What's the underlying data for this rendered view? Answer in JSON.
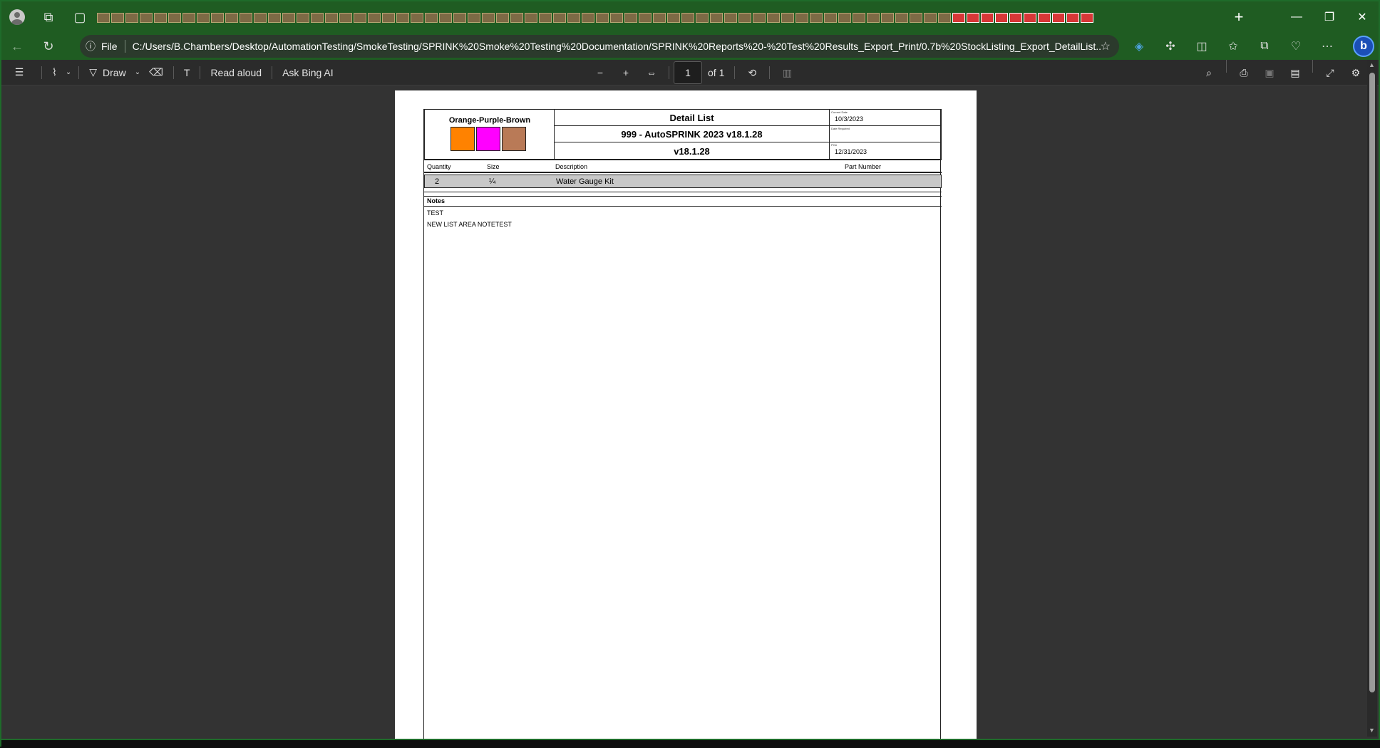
{
  "browser": {
    "url": "C:/Users/B.Chambers/Desktop/AutomationTesting/SmokeTesting/SPRINK%20Smoke%20Testing%20Documentation/SPRINK%20Reports%20-%20Test%20Results_Export_Print/0.7b%20StockListing_Export_DetailList....",
    "file_label": "File",
    "tab_count_generic": 60,
    "tab_count_pdf": 10
  },
  "pdf_toolbar": {
    "draw_label": "Draw",
    "read_aloud_label": "Read aloud",
    "ask_bing_label": "Ask Bing AI",
    "page_number": "1",
    "page_of": "of 1"
  },
  "document": {
    "color_title": "Orange-Purple-Brown",
    "colors": [
      "#ff8200",
      "#ff00ff",
      "#b97a57"
    ],
    "title": "Detail List",
    "project": "999 - AutoSPRINK 2023 v18.1.28",
    "version": "v18.1.28",
    "current_date_label": "Current Date",
    "current_date": "10/3/2023",
    "date_required_label": "Date Required",
    "date_required": "",
    "po_label": "PO#",
    "po_value": "12/31/2023",
    "columns": {
      "quantity": "Quantity",
      "size": "Size",
      "description": "Description",
      "part_number": "Part Number"
    },
    "rows": [
      {
        "quantity": "2",
        "size": "¼",
        "description": "Water Gauge Kit",
        "part_number": ""
      }
    ],
    "notes_label": "Notes",
    "notes": [
      "TEST",
      "NEW LIST AREA NOTETEST"
    ]
  }
}
